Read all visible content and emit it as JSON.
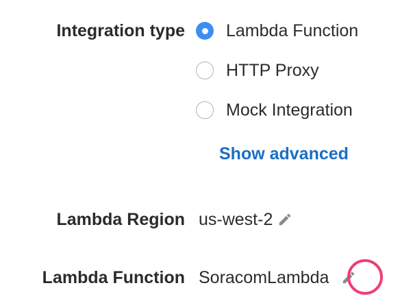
{
  "integration": {
    "label": "Integration type",
    "options": [
      {
        "label": "Lambda Function",
        "selected": true
      },
      {
        "label": "HTTP Proxy",
        "selected": false
      },
      {
        "label": "Mock Integration",
        "selected": false
      }
    ],
    "show_advanced": "Show advanced"
  },
  "lambda_region": {
    "label": "Lambda Region",
    "value": "us-west-2",
    "edit_icon": "pencil-icon"
  },
  "lambda_function": {
    "label": "Lambda Function",
    "value": "SoracomLambda",
    "edit_icon": "pencil-icon"
  },
  "colors": {
    "accent": "#3d8ef2",
    "link": "#1a6fc4",
    "highlight": "#ef3f73",
    "icon": "#8a8a8a"
  }
}
